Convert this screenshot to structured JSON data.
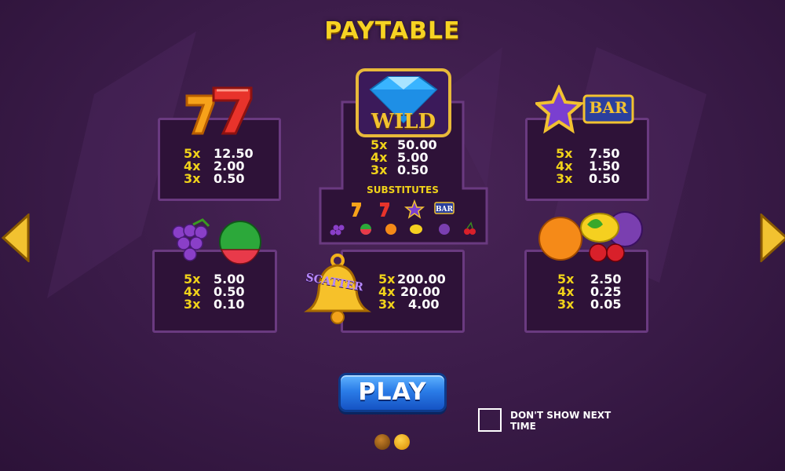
{
  "title": "PAYTABLE",
  "colors": {
    "background": "#3a1b48",
    "panel_border": "#6a3a80",
    "accent": "#f0d21a",
    "play_button": "#2b7de8"
  },
  "symbols": {
    "sevens": {
      "icon": "lucky-sevens-icon",
      "pays": [
        {
          "mult": "5x",
          "value": "12.50"
        },
        {
          "mult": "4x",
          "value": "2.00"
        },
        {
          "mult": "3x",
          "value": "0.50"
        }
      ]
    },
    "wild": {
      "icon": "diamond-wild-icon",
      "label": "WILD",
      "pays": [
        {
          "mult": "5x",
          "value": "50.00"
        },
        {
          "mult": "4x",
          "value": "5.00"
        },
        {
          "mult": "3x",
          "value": "0.50"
        }
      ],
      "substitutes_label": "SUBSTITUTES",
      "substitutes": [
        "seven-orange",
        "seven-red",
        "star",
        "bar",
        "grapes",
        "watermelon",
        "orange",
        "lemon",
        "plum",
        "cherries"
      ]
    },
    "star_bar": {
      "icon": "star-and-bar-icon",
      "bar_label": "BAR",
      "pays": [
        {
          "mult": "5x",
          "value": "7.50"
        },
        {
          "mult": "4x",
          "value": "1.50"
        },
        {
          "mult": "3x",
          "value": "0.50"
        }
      ]
    },
    "grapes_melon": {
      "icon": "grapes-watermelon-icon",
      "pays": [
        {
          "mult": "5x",
          "value": "5.00"
        },
        {
          "mult": "4x",
          "value": "0.50"
        },
        {
          "mult": "3x",
          "value": "0.10"
        }
      ]
    },
    "scatter": {
      "icon": "bell-scatter-icon",
      "label": "SCATTER",
      "pays": [
        {
          "mult": "5x",
          "value": "200.00"
        },
        {
          "mult": "4x",
          "value": "20.00"
        },
        {
          "mult": "3x",
          "value": "4.00"
        }
      ]
    },
    "fruits": {
      "icon": "orange-lemon-plum-cherries-icon",
      "pays": [
        {
          "mult": "5x",
          "value": "2.50"
        },
        {
          "mult": "4x",
          "value": "0.25"
        },
        {
          "mult": "3x",
          "value": "0.05"
        }
      ]
    }
  },
  "play_label": "PLAY",
  "dont_show_label": "DON'T SHOW NEXT TIME",
  "pagination": {
    "pages": 2,
    "current": 2
  }
}
